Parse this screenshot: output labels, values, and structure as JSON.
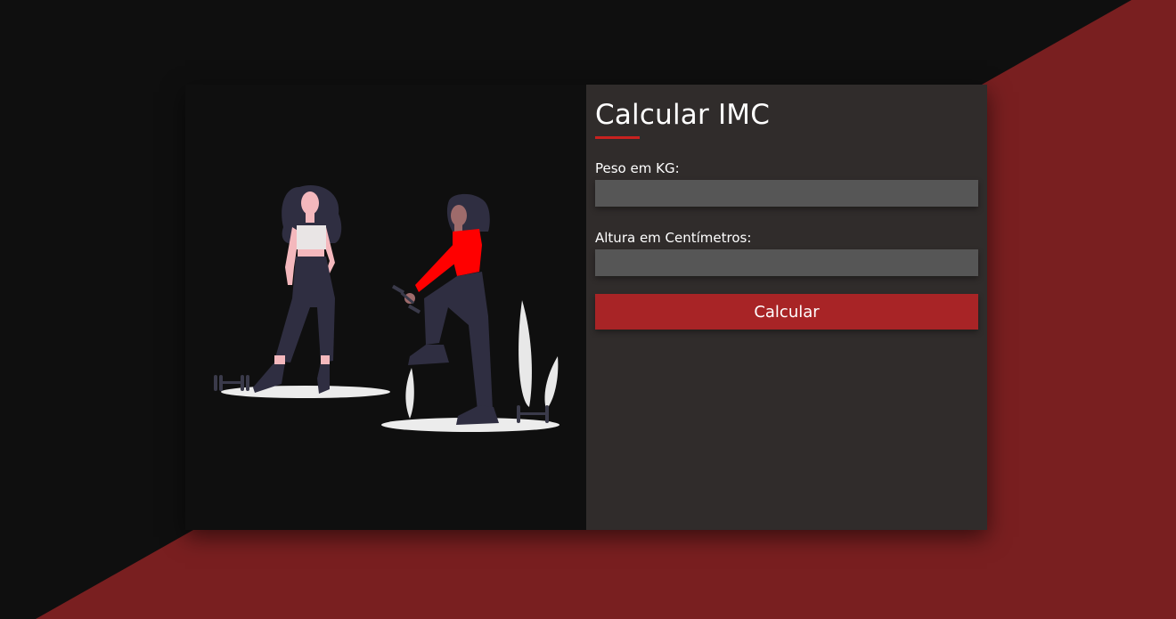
{
  "colors": {
    "background_dark": "#0f0f0f",
    "background_accent": "#791f20",
    "panel_dark": "#302c2b",
    "input_bg": "#565656",
    "button_bg": "#a82426",
    "underline": "#c8211f",
    "text": "#ffffff"
  },
  "form": {
    "title": "Calcular IMC",
    "weight_label": "Peso em KG:",
    "weight_value": "",
    "height_label": "Altura em Centímetros:",
    "height_value": "",
    "submit_label": "Calcular"
  },
  "illustration": {
    "icon": "women-exercising-illustration"
  }
}
